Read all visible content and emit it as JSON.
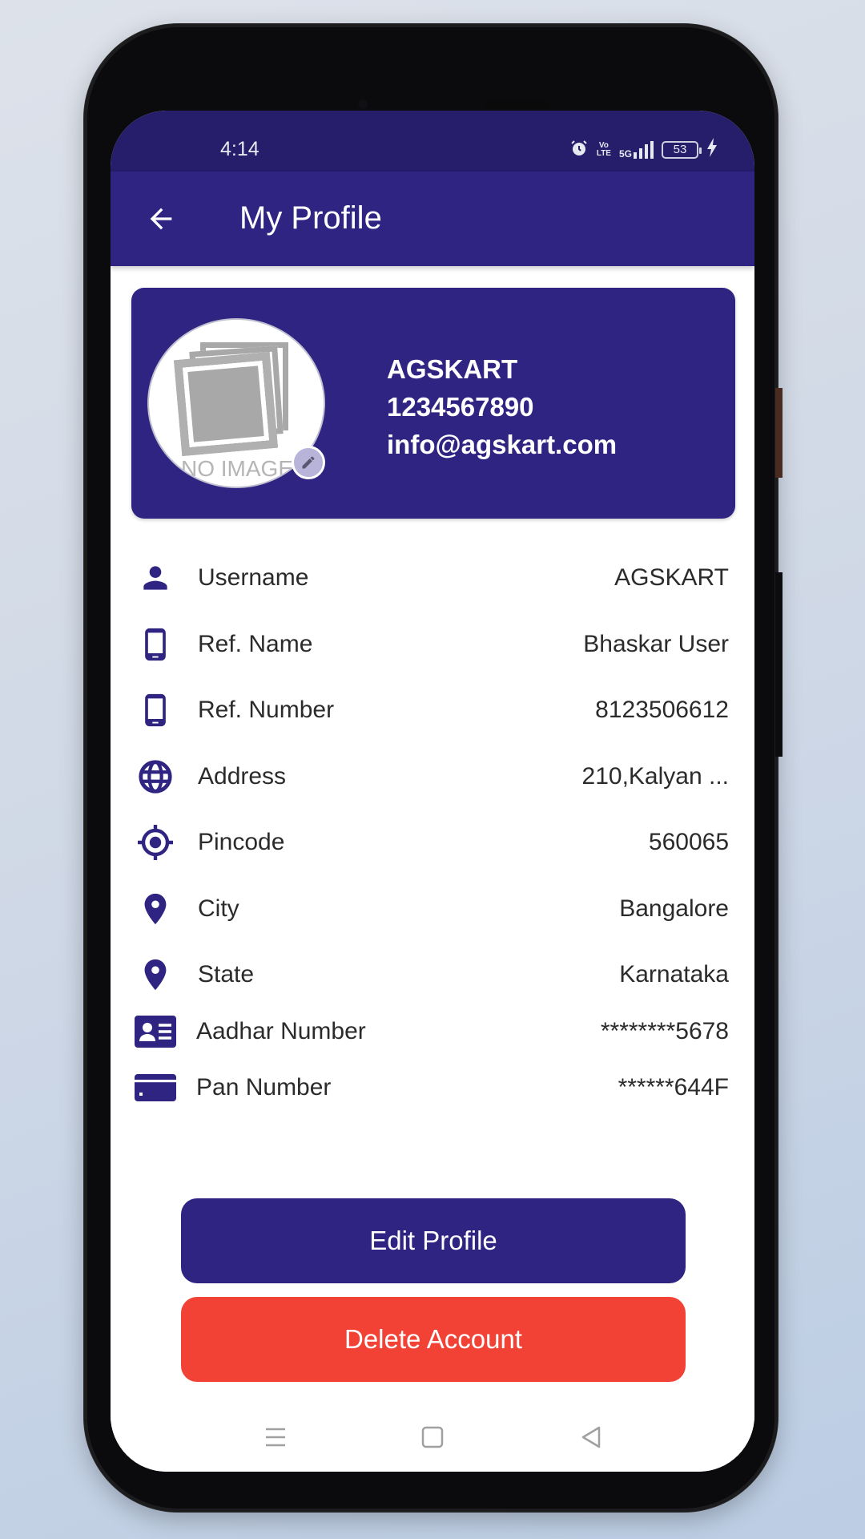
{
  "status_bar": {
    "time": "4:14",
    "network_label": "5G",
    "volte_label": "Vo LTE",
    "battery_level": "53",
    "icons": [
      "alarm-icon",
      "volte-icon",
      "signal-5g-icon",
      "battery-icon",
      "charging-icon"
    ]
  },
  "app_bar": {
    "back_icon": "arrow-left-icon",
    "title": "My Profile"
  },
  "profile_card": {
    "avatar_placeholder_text": "NO IMAGE",
    "name": "AGSKART",
    "phone": "1234567890",
    "email": "info@agskart.com"
  },
  "details": [
    {
      "icon": "person-icon",
      "label": "Username",
      "value": "AGSKART"
    },
    {
      "icon": "smartphone-icon",
      "label": "Ref. Name",
      "value": "Bhaskar User"
    },
    {
      "icon": "smartphone-icon",
      "label": "Ref. Number",
      "value": "8123506612"
    },
    {
      "icon": "globe-icon",
      "label": "Address",
      "value": "210,Kalyan ..."
    },
    {
      "icon": "gps-target-icon",
      "label": "Pincode",
      "value": "560065"
    },
    {
      "icon": "location-pin-icon",
      "label": "City",
      "value": "Bangalore"
    },
    {
      "icon": "location-pin-icon",
      "label": "State",
      "value": "Karnataka"
    },
    {
      "icon": "id-card-icon",
      "label": "Aadhar Number",
      "value": "********5678"
    },
    {
      "icon": "credit-card-icon",
      "label": "Pan Number",
      "value": "******644F"
    }
  ],
  "actions": {
    "edit_profile": "Edit Profile",
    "delete_account": "Delete Account"
  },
  "nav_bar": {
    "buttons": [
      "menu-icon",
      "home-square-icon",
      "back-triangle-icon"
    ]
  },
  "colors": {
    "primary": "#302483",
    "status_bar": "#261d6b",
    "danger": "#f24236",
    "text": "#2b2b2b"
  }
}
